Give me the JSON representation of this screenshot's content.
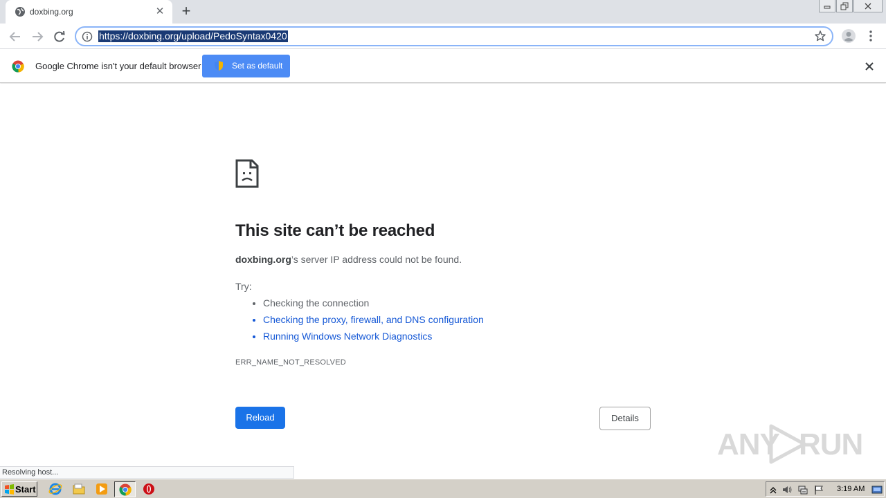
{
  "browser": {
    "tab": {
      "title": "doxbing.org",
      "close_glyph": "✕"
    },
    "new_tab_glyph": "+",
    "address_bar": {
      "url": "https://doxbing.org/upload/PedoSyntax0420"
    }
  },
  "infobar": {
    "message": "Google Chrome isn't your default browser",
    "set_default_label": "Set as default"
  },
  "error_page": {
    "title": "This site can’t be reached",
    "domain": "doxbing.org",
    "description_suffix": "’s server IP address could not be found.",
    "try_label": "Try:",
    "suggestions": [
      {
        "text": "Checking the connection",
        "link": false
      },
      {
        "text": "Checking the proxy, firewall, and DNS configuration",
        "link": true
      },
      {
        "text": "Running Windows Network Diagnostics",
        "link": true
      }
    ],
    "error_code": "ERR_NAME_NOT_RESOLVED",
    "reload_label": "Reload",
    "details_label": "Details"
  },
  "status_bubble": "Resolving host...",
  "watermark": {
    "left": "ANY",
    "right": "RUN"
  },
  "taskbar": {
    "start_label": "Start",
    "clock": "3:19 AM",
    "pinned_icons": [
      "internet-explorer-icon",
      "file-explorer-icon",
      "media-player-icon",
      "chrome-icon",
      "opera-icon"
    ]
  },
  "colors": {
    "accent_blue": "#1a73e8",
    "link_blue": "#1558d6",
    "infobar_button": "#4c8bf5",
    "url_selection": "#1a3a75"
  }
}
